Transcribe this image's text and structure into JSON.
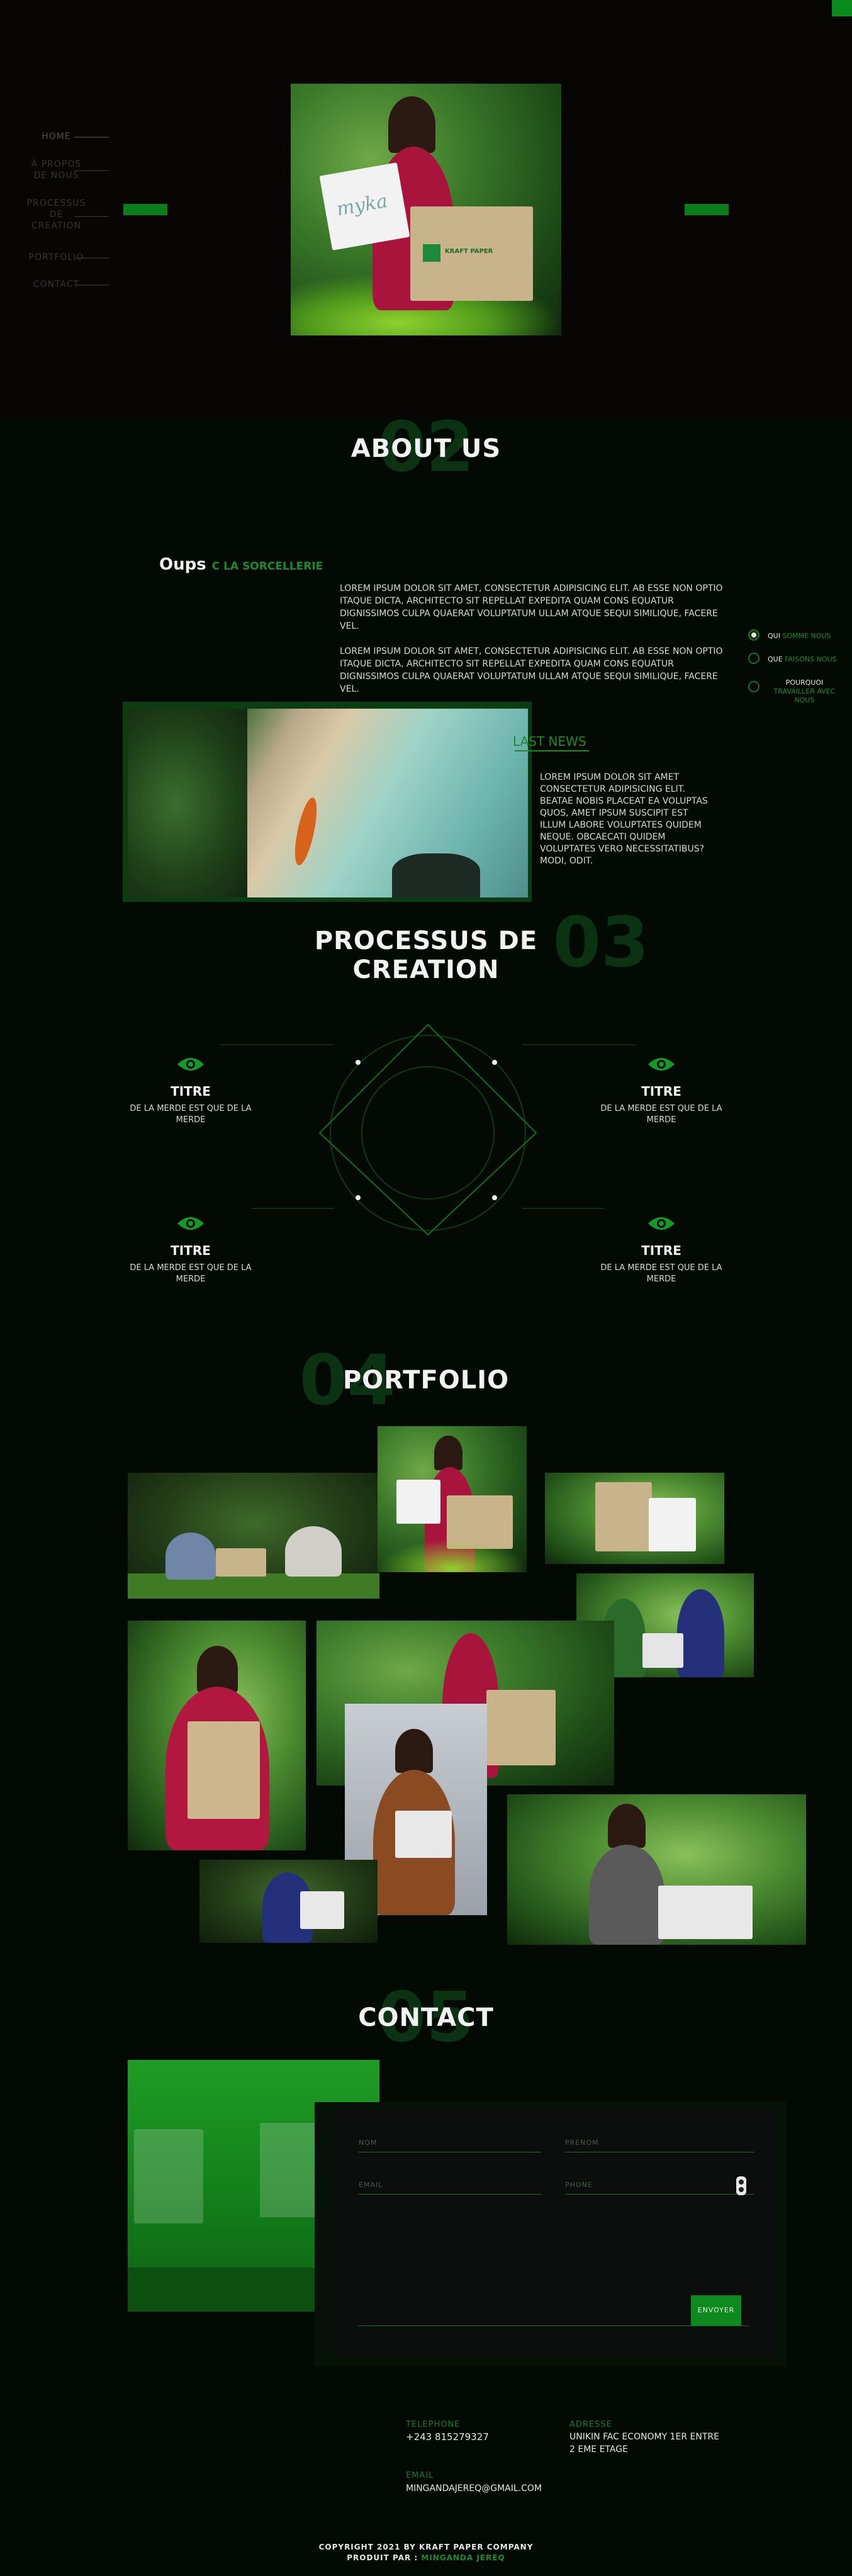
{
  "colors": {
    "accent": "#0d8a1e",
    "background": "#030a04",
    "hero_bg": "#080505"
  },
  "nav": {
    "items": [
      {
        "label": "HOME"
      },
      {
        "label": "À PROPOS\nDE NOUS"
      },
      {
        "label": "PROCESSUS\nDE\nCREATION"
      },
      {
        "label": "PORTFOLIO"
      },
      {
        "label": "CONTACT"
      }
    ]
  },
  "hero": {
    "bag_text": "myka",
    "kraft_label": "KRAFT PAPER"
  },
  "about": {
    "number": "02",
    "title": "ABOUT US",
    "heading_white": "Oups",
    "heading_green": "c la sorcellerie",
    "para1": "Lorem ipsum dolor sit amet, consectetur adipisicing elit. Ab esse non optio itaque dicta, architecto sit repellat expedita quam cons equatur dignissimos culpa quaerat voluptatum ullam atque sequi similique, facere vel.",
    "para2": "Lorem ipsum dolor sit amet, consectetur adipisicing elit. Ab esse non optio itaque dicta, architecto sit repellat expedita quam cons equatur dignissimos culpa quaerat voluptatum ullam atque sequi similique, facere vel.",
    "options": [
      {
        "white": "QUI",
        "green": "SOMME NOUS"
      },
      {
        "white": "QUE",
        "green": "FAISONS NOUS"
      },
      {
        "white": "POURQUOI",
        "green": "TRAVAILLER AVEC NOUS"
      }
    ],
    "news_title": "LAST NEWS",
    "news_text": "Lorem ipsum dolor sit amet consectetur adipisicing elit. Beatae nobis placeat ea voluptas quos, amet ipsum suscipit est illum labore voluptates quidem neque. Obcaecati quidem voluptates vero necessitatibus? Modi, odit."
  },
  "process": {
    "number": "03",
    "title": "PROCESSUS DE CREATION",
    "items": [
      {
        "title": "TITRE",
        "desc": "DE LA MERDE EST QUE DE LA MERDE"
      },
      {
        "title": "TITRE",
        "desc": "DE LA MERDE EST QUE DE LA MERDE"
      },
      {
        "title": "TITRE",
        "desc": "DE LA MERDE EST QUE DE LA MERDE"
      },
      {
        "title": "TITRE",
        "desc": "DE LA MERDE EST QUE DE LA MERDE"
      }
    ]
  },
  "portfolio": {
    "number": "04",
    "title": "PORTFOLIO"
  },
  "contact": {
    "number": "05",
    "title": "CONTACT",
    "fields": {
      "nom": "NOM",
      "prenom": "PRENOM",
      "email": "EMAIL",
      "phone": "PHONE"
    },
    "submit": "ENVOYER",
    "telephone_label": "TELEPHONE",
    "telephone_value": "+243 815279327",
    "adresse_label": "ADRESSE",
    "adresse_value": "UNIKIN FAC ECONOMY 1ER ENTRE 2 EME ETAGE",
    "email_label": "EMAIL",
    "email_value": "MINGANDAJEREQ@GMAIL.COM"
  },
  "footer": {
    "line1": "COPYRIGHT 2021 BY KRAFT PAPER COMPANY",
    "line2_white": "PRODUIT PAR :",
    "line2_green": "MINGANDA JEREQ"
  }
}
